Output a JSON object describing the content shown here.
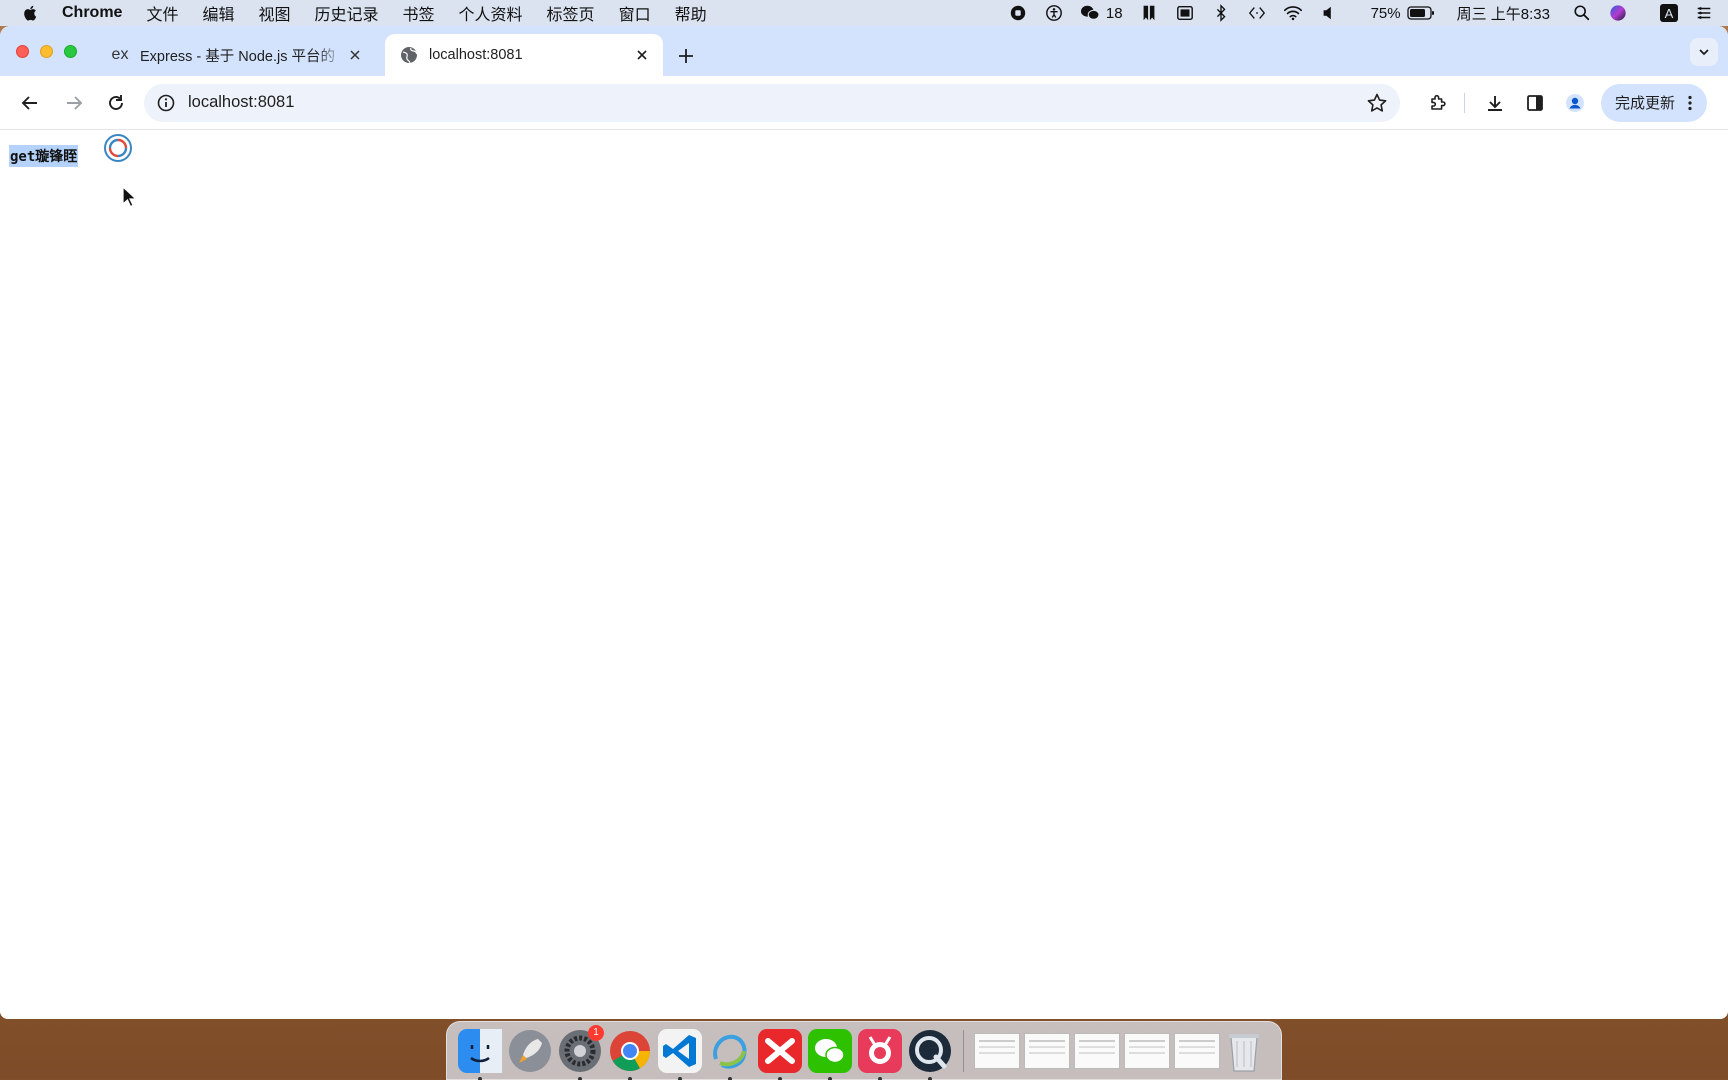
{
  "menubar": {
    "app_name": "Chrome",
    "menus": [
      "文件",
      "编辑",
      "视图",
      "历史记录",
      "书签",
      "个人资料",
      "标签页",
      "窗口",
      "帮助"
    ],
    "wechat_count": "18",
    "battery": "75%",
    "datetime": "周三 上午8:33",
    "input_method": "A"
  },
  "tabs": [
    {
      "favicon_text": "ex",
      "title": "Express - 基于 Node.js 平台的"
    },
    {
      "title": "localhost:8081"
    }
  ],
  "toolbar": {
    "url": "localhost:8081",
    "update_label": "完成更新"
  },
  "page": {
    "text": "get璇锋眰"
  },
  "dock": {
    "settings_badge": "1"
  }
}
